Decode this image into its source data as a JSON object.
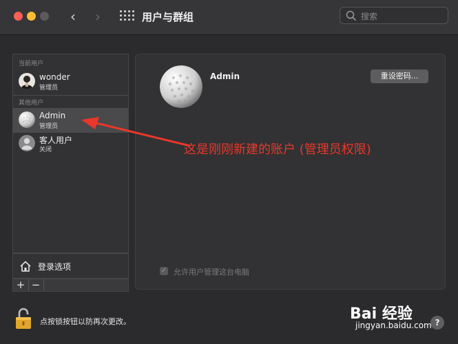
{
  "titlebar": {
    "title": "用户与群组",
    "search_placeholder": "搜索"
  },
  "sidebar": {
    "current_users_label": "当前用户",
    "other_users_label": "其他用户",
    "users": [
      {
        "name": "wonder",
        "role": "管理员",
        "avatar": "photo-avatar"
      },
      {
        "name": "Admin",
        "role": "管理员",
        "avatar": "golf-ball-avatar",
        "selected": true
      },
      {
        "name": "客人用户",
        "role": "关闭",
        "avatar": "generic-user-icon"
      }
    ],
    "login_options_label": "登录选项",
    "add_symbol": "+",
    "remove_symbol": "−"
  },
  "detail": {
    "name": "Admin",
    "reset_password_label": "重设密码...",
    "allow_admin_label": "允许用户管理这台电脑",
    "allow_admin_checked": true
  },
  "footer": {
    "lock_text": "点按锁按钮以防再次更改。",
    "help_label": "?"
  },
  "annotation": {
    "text": "这是刚刚新建的账户 (管理员权限)",
    "color": "#e8382b"
  },
  "watermark": {
    "logo": "Bai  经验",
    "url": "jingyan.baidu.com"
  }
}
